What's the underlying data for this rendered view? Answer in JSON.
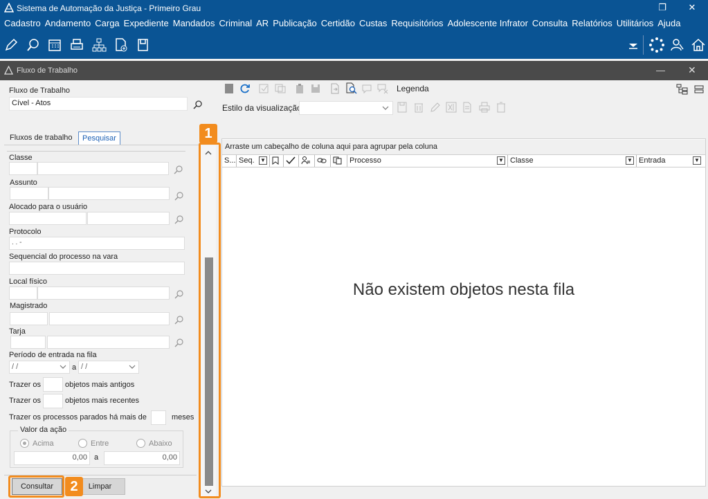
{
  "window": {
    "title": "Sistema de Automação da Justiça - Primeiro Grau",
    "restore_glyph": "❐",
    "close_glyph": "✕"
  },
  "menu": [
    "Cadastro",
    "Andamento",
    "Carga",
    "Expediente",
    "Mandados",
    "Criminal",
    "AR",
    "Publicação",
    "Certidão",
    "Custas",
    "Requisitórios",
    "Adolescente Infrator",
    "Consulta",
    "Relatórios",
    "Utilitários",
    "Ajuda"
  ],
  "subwindow": {
    "title": "Fluxo de Trabalho",
    "minimize_glyph": "—",
    "close_glyph": "✕"
  },
  "left": {
    "fluxo_label": "Fluxo de Trabalho",
    "fluxo_value": "Cível - Atos",
    "tabs": [
      "Fluxos de trabalho",
      "Pesquisar"
    ],
    "classe": "Classe",
    "assunto": "Assunto",
    "alocado": "Alocado para o usuário",
    "protocolo": "Protocolo",
    "protocolo_value": " .  .   -",
    "sequencial": "Sequencial do processo na vara",
    "local_fisico": "Local físico",
    "magistrado": "Magistrado",
    "tarja": "Tarja",
    "periodo": "Período de entrada na fila",
    "date_placeholder": " / /",
    "a": "a",
    "trazer_os": "Trazer os",
    "antigos": "objetos mais antigos",
    "recentes": "objetos mais recentes",
    "parados": "Trazer os processos parados há mais de",
    "meses": "meses",
    "valor_acao": "Valor da ação",
    "acima": "Acima",
    "entre": "Entre",
    "abaixo": "Abaixo",
    "valor_min": "0,00",
    "valor_max": "0,00",
    "consultar": "Consultar",
    "limpar": "Limpar"
  },
  "right": {
    "legenda": "Legenda",
    "estilo": "Estilo da visualização",
    "group_hint": "Arraste um cabeçalho de coluna aqui para agrupar pela coluna",
    "columns": [
      "S...",
      "Seq.",
      "Processo",
      "Classe",
      "Entrada"
    ],
    "empty": "Não existem objetos nesta fila"
  },
  "callouts": [
    "1",
    "2"
  ]
}
